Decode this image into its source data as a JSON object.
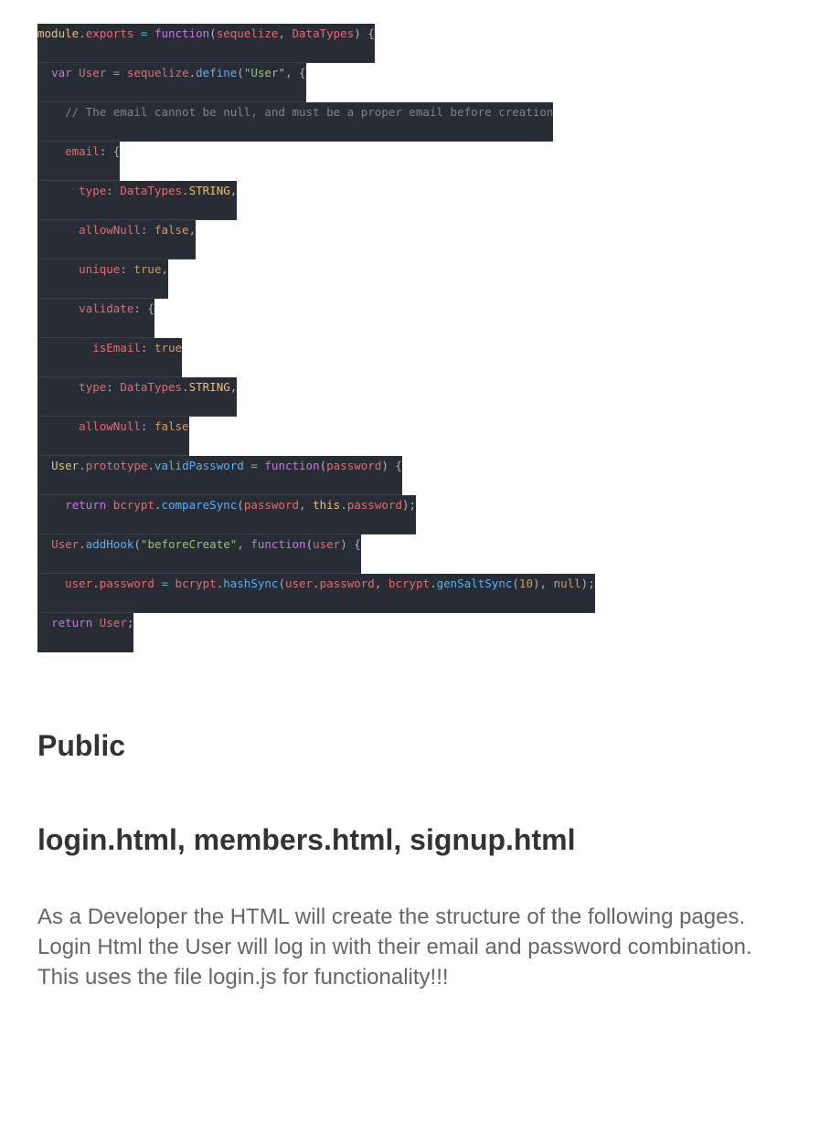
{
  "code": {
    "lines": [
      [
        [
          "module",
          "t-cls"
        ],
        [
          ".",
          "t-plain"
        ],
        [
          "exports",
          "t-prop"
        ],
        [
          " = ",
          "t-op"
        ],
        [
          "function",
          "t-kw"
        ],
        [
          "(",
          "t-plain"
        ],
        [
          "sequelize",
          "t-prop"
        ],
        [
          ", ",
          "t-plain"
        ],
        [
          "DataTypes",
          "t-prop"
        ],
        [
          ") {",
          "t-plain"
        ]
      ],
      [
        [
          "  ",
          "t-plain"
        ],
        [
          "var",
          "t-kw"
        ],
        [
          " ",
          "t-plain"
        ],
        [
          "User",
          "t-prop"
        ],
        [
          " = ",
          "t-op"
        ],
        [
          "sequelize",
          "t-prop"
        ],
        [
          ".",
          "t-plain"
        ],
        [
          "define",
          "t-fn"
        ],
        [
          "(",
          "t-plain"
        ],
        [
          "\"User\"",
          "t-str"
        ],
        [
          ", {",
          "t-plain"
        ]
      ],
      [
        [
          "    // The email cannot be null, and must be a proper email before creation",
          "t-cmt"
        ]
      ],
      [
        [
          "    ",
          "t-plain"
        ],
        [
          "email",
          "t-prop"
        ],
        [
          ": {",
          "t-plain"
        ]
      ],
      [
        [
          "      ",
          "t-plain"
        ],
        [
          "type",
          "t-prop"
        ],
        [
          ": ",
          "t-plain"
        ],
        [
          "DataTypes",
          "t-prop"
        ],
        [
          ".",
          "t-plain"
        ],
        [
          "STRING",
          "t-cls"
        ],
        [
          ",",
          "t-plain"
        ]
      ],
      [
        [
          "      ",
          "t-plain"
        ],
        [
          "allowNull",
          "t-prop"
        ],
        [
          ": ",
          "t-plain"
        ],
        [
          "false",
          "t-num"
        ],
        [
          ",",
          "t-plain"
        ]
      ],
      [
        [
          "      ",
          "t-plain"
        ],
        [
          "unique",
          "t-prop"
        ],
        [
          ": ",
          "t-plain"
        ],
        [
          "true",
          "t-num"
        ],
        [
          ",",
          "t-plain"
        ]
      ],
      [
        [
          "      ",
          "t-plain"
        ],
        [
          "validate",
          "t-prop"
        ],
        [
          ": {",
          "t-plain"
        ]
      ],
      [
        [
          "        ",
          "t-plain"
        ],
        [
          "isEmail",
          "t-prop"
        ],
        [
          ": ",
          "t-plain"
        ],
        [
          "true",
          "t-num"
        ]
      ],
      [
        [
          "      ",
          "t-plain"
        ],
        [
          "type",
          "t-prop"
        ],
        [
          ": ",
          "t-plain"
        ],
        [
          "DataTypes",
          "t-prop"
        ],
        [
          ".",
          "t-plain"
        ],
        [
          "STRING",
          "t-cls"
        ],
        [
          ",",
          "t-plain"
        ]
      ],
      [
        [
          "      ",
          "t-plain"
        ],
        [
          "allowNull",
          "t-prop"
        ],
        [
          ": ",
          "t-plain"
        ],
        [
          "false",
          "t-num"
        ]
      ],
      [
        [
          "  ",
          "t-plain"
        ],
        [
          "User",
          "t-cls"
        ],
        [
          ".",
          "t-plain"
        ],
        [
          "prototype",
          "t-prop"
        ],
        [
          ".",
          "t-plain"
        ],
        [
          "validPassword",
          "t-fn"
        ],
        [
          " = ",
          "t-op"
        ],
        [
          "function",
          "t-kw"
        ],
        [
          "(",
          "t-plain"
        ],
        [
          "password",
          "t-prop"
        ],
        [
          ") {",
          "t-plain"
        ]
      ],
      [
        [
          "    ",
          "t-plain"
        ],
        [
          "return",
          "t-kw"
        ],
        [
          " ",
          "t-plain"
        ],
        [
          "bcrypt",
          "t-prop"
        ],
        [
          ".",
          "t-plain"
        ],
        [
          "compareSync",
          "t-fn"
        ],
        [
          "(",
          "t-plain"
        ],
        [
          "password",
          "t-prop"
        ],
        [
          ", ",
          "t-plain"
        ],
        [
          "this",
          "t-cls"
        ],
        [
          ".",
          "t-plain"
        ],
        [
          "password",
          "t-prop"
        ],
        [
          ");",
          "t-plain"
        ]
      ],
      [
        [
          "  ",
          "t-plain"
        ],
        [
          "User",
          "t-prop"
        ],
        [
          ".",
          "t-plain"
        ],
        [
          "addHook",
          "t-fn"
        ],
        [
          "(",
          "t-plain"
        ],
        [
          "\"beforeCreate\"",
          "t-str"
        ],
        [
          ", ",
          "t-plain"
        ],
        [
          "function",
          "t-kw"
        ],
        [
          "(",
          "t-plain"
        ],
        [
          "user",
          "t-prop"
        ],
        [
          ") {",
          "t-plain"
        ]
      ],
      [
        [
          "    ",
          "t-plain"
        ],
        [
          "user",
          "t-prop"
        ],
        [
          ".",
          "t-plain"
        ],
        [
          "password",
          "t-prop"
        ],
        [
          " = ",
          "t-op"
        ],
        [
          "bcrypt",
          "t-prop"
        ],
        [
          ".",
          "t-plain"
        ],
        [
          "hashSync",
          "t-fn"
        ],
        [
          "(",
          "t-plain"
        ],
        [
          "user",
          "t-prop"
        ],
        [
          ".",
          "t-plain"
        ],
        [
          "password",
          "t-prop"
        ],
        [
          ", ",
          "t-plain"
        ],
        [
          "bcrypt",
          "t-prop"
        ],
        [
          ".",
          "t-plain"
        ],
        [
          "genSaltSync",
          "t-fn"
        ],
        [
          "(",
          "t-plain"
        ],
        [
          "10",
          "t-num"
        ],
        [
          "), ",
          "t-plain"
        ],
        [
          "null",
          "t-num"
        ],
        [
          ");",
          "t-plain"
        ]
      ],
      [
        [
          "  ",
          "t-plain"
        ],
        [
          "return",
          "t-kw"
        ],
        [
          " ",
          "t-plain"
        ],
        [
          "User",
          "t-prop"
        ],
        [
          ";",
          "t-plain"
        ]
      ]
    ]
  },
  "headings": {
    "public": "Public",
    "files": "login.html, members.html, signup.html"
  },
  "description": {
    "line1": "As a Developer the HTML will create the structure of the following pages.",
    "line2": "Login Html the User will log in with their email and password combination.",
    "line3": "This uses the file login.js for functionality!!!"
  }
}
